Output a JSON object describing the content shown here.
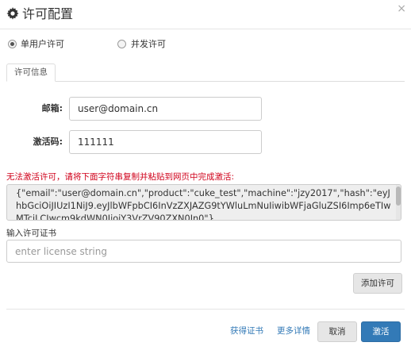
{
  "dialog": {
    "title": "许可配置",
    "close_symbol": "×",
    "icon": "gear-icon"
  },
  "license_mode": {
    "options": [
      {
        "label": "单用户许可",
        "checked": true
      },
      {
        "label": "并发许可",
        "checked": false
      }
    ]
  },
  "tabs": [
    {
      "label": "许可信息",
      "active": true
    }
  ],
  "form": {
    "email_label": "邮箱:",
    "email_value": "user@domain.cn",
    "activation_code_label": "激活码:",
    "activation_code_value": "111111"
  },
  "warning_text": "无法激活许可，请将下面字符串复制并粘贴到网页中完成激活:",
  "activation_request": "{\"email\":\"user@domain.cn\",\"product\":\"cuke_test\",\"machine\":\"jzy2017\",\"hash\":\"eyJhbGciOiJIUzI1NiJ9.eyJlbWFpbCI6InVzZXJAZG9tYWluLmNuIiwibWFjaGluZSI6Imp6eTIwMTciLCJwcm9kdWN0IjoiY3VrZV90ZXN0In0\"}",
  "license": {
    "label": "输入许可证书",
    "placeholder": "enter license string"
  },
  "buttons": {
    "add_license": "添加许可",
    "cancel": "取消",
    "activate": "激活"
  },
  "links": {
    "get_certificate": "获得证书",
    "more_details": "更多详情"
  },
  "colors": {
    "primary": "#337ab7",
    "warning": "#d0021b",
    "link": "#337ab7"
  }
}
